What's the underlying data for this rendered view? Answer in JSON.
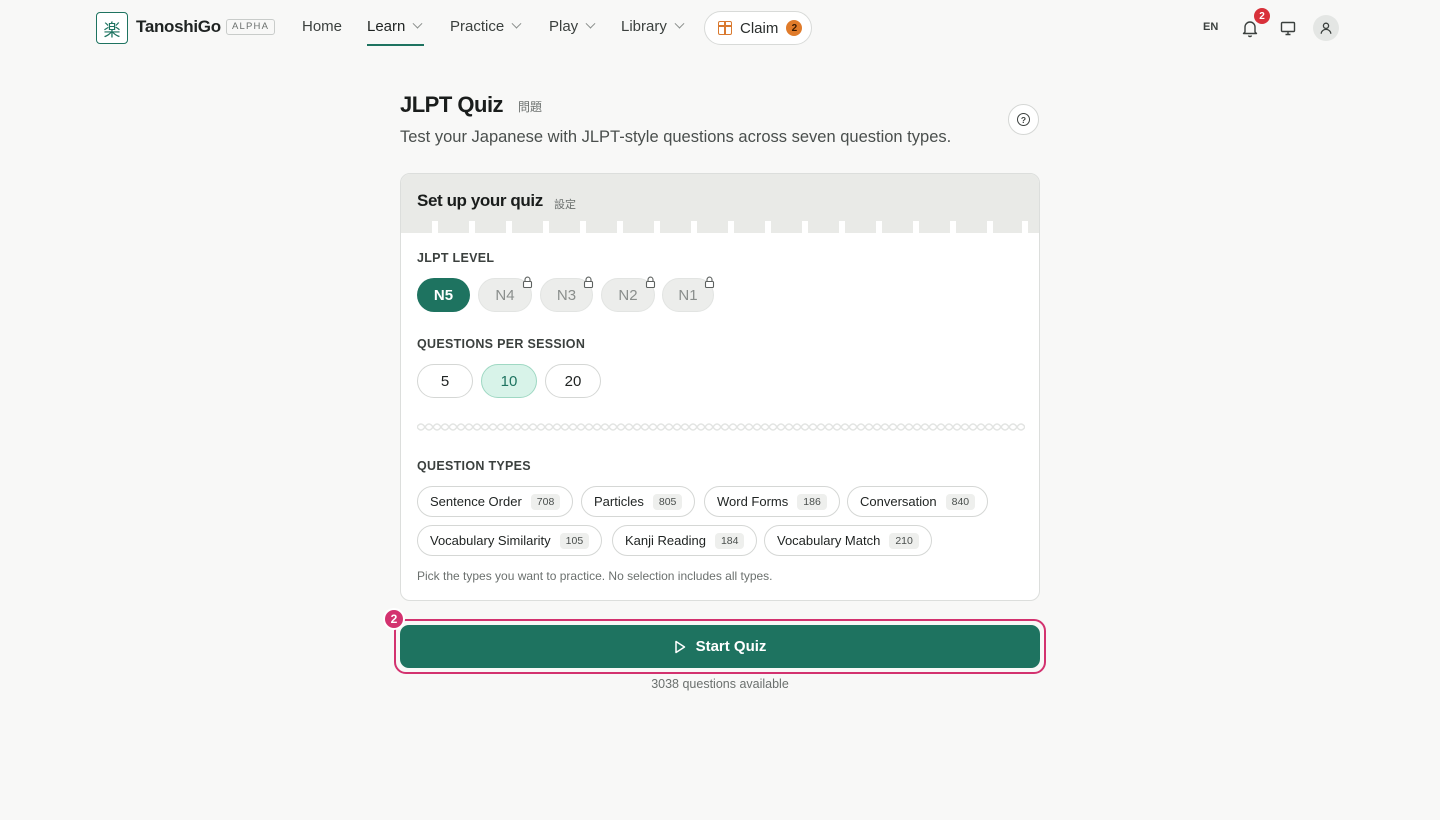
{
  "nav": {
    "logo_glyph": "楽",
    "brand": "TanoshiGo",
    "badge": "ALPHA",
    "items": [
      {
        "label": "Home"
      },
      {
        "label": "Learn"
      },
      {
        "label": "Practice"
      },
      {
        "label": "Play"
      },
      {
        "label": "Library"
      }
    ],
    "claim": {
      "label": "Claim",
      "count": "2"
    },
    "language": "EN",
    "notifications_count": "2"
  },
  "header": {
    "title": "JLPT Quiz",
    "title_jp": "問題",
    "subtitle": "Test your Japanese with JLPT-style questions across seven question types."
  },
  "setup": {
    "title": "Set up your quiz",
    "title_jp": "設定",
    "level_label": "JLPT LEVEL",
    "levels": [
      {
        "label": "N5",
        "selected": true,
        "locked": false
      },
      {
        "label": "N4",
        "selected": false,
        "locked": true
      },
      {
        "label": "N3",
        "selected": false,
        "locked": true
      },
      {
        "label": "N2",
        "selected": false,
        "locked": true
      },
      {
        "label": "N1",
        "selected": false,
        "locked": true
      }
    ],
    "qps_label": "QUESTIONS PER SESSION",
    "qps_options": [
      {
        "label": "5",
        "selected": false
      },
      {
        "label": "10",
        "selected": true
      },
      {
        "label": "20",
        "selected": false
      }
    ],
    "types_label": "QUESTION TYPES",
    "types": [
      {
        "label": "Sentence Order",
        "count": "708"
      },
      {
        "label": "Particles",
        "count": "805"
      },
      {
        "label": "Word Forms",
        "count": "186"
      },
      {
        "label": "Conversation",
        "count": "840"
      },
      {
        "label": "Vocabulary Similarity",
        "count": "105"
      },
      {
        "label": "Kanji Reading",
        "count": "184"
      },
      {
        "label": "Vocabulary Match",
        "count": "210"
      }
    ],
    "hint": "Pick the types you want to practice. No selection includes all types."
  },
  "start": {
    "label": "Start Quiz",
    "step": "2",
    "available": "3038 questions available"
  },
  "colors": {
    "accent": "#1e7360",
    "highlight": "#d3326f",
    "selected_bg": "#d8f3e9",
    "claim_orange": "#e07b2a",
    "badge_red": "#d8313a"
  }
}
